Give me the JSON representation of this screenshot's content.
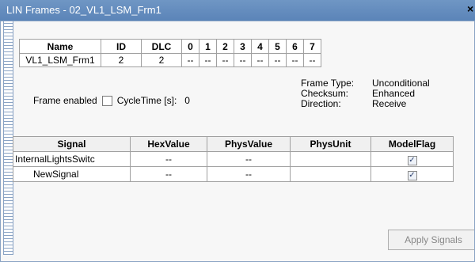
{
  "window": {
    "title": "LIN Frames - 02_VL1_LSM_Frm1",
    "close_glyph": "×"
  },
  "frame_table": {
    "headers": [
      "Name",
      "ID",
      "DLC",
      "0",
      "1",
      "2",
      "3",
      "4",
      "5",
      "6",
      "7"
    ],
    "row": [
      "VL1_LSM_Frm1",
      "2",
      "2",
      "--",
      "--",
      "--",
      "--",
      "--",
      "--",
      "--",
      "--"
    ]
  },
  "frame_enabled_label": "Frame enabled",
  "frame_enabled_checked": false,
  "cycletime_label": "CycleTime [s]:",
  "cycletime_value": "0",
  "frame_info": {
    "frame_type_label": "Frame Type:",
    "frame_type_value": "Unconditional",
    "checksum_label": "Checksum:",
    "checksum_value": "Enhanced",
    "direction_label": "Direction:",
    "direction_value": "Receive"
  },
  "signal_table": {
    "headers": [
      "Signal",
      "HexValue",
      "PhysValue",
      "PhysUnit",
      "ModelFlag"
    ],
    "rows": [
      {
        "signal": "InternalLightsSwitc",
        "hex": "--",
        "phys": "--",
        "unit": "",
        "model_flag": true
      },
      {
        "signal": "NewSignal",
        "hex": "--",
        "phys": "--",
        "unit": "",
        "model_flag": true
      }
    ]
  },
  "apply_button_label": "Apply Signals",
  "apply_button_enabled": false
}
